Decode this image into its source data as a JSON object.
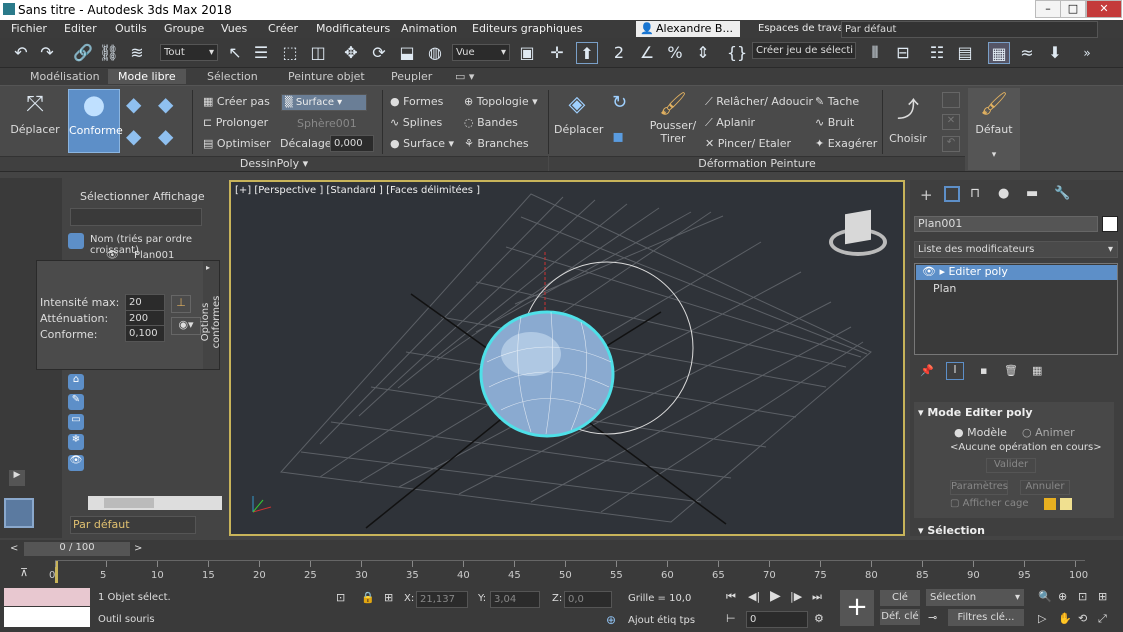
{
  "window": {
    "title": "Sans titre - Autodesk 3ds Max 2018"
  },
  "menu": [
    "Fichier",
    "Editer",
    "Outils",
    "Groupe",
    "Vues",
    "Créer",
    "Modificateurs",
    "Animation",
    "Editeurs graphiques"
  ],
  "user": "Alexandre B...",
  "workspace": {
    "label": "Espaces de travail:",
    "value": "Par défaut"
  },
  "toolbar": {
    "filter": "Tout",
    "view": "Vue",
    "selection_set": "Créer jeu de sélecti"
  },
  "ribbon_tabs": [
    "Modélisation",
    "Mode libre",
    "Sélection",
    "Peinture objet",
    "Peupler"
  ],
  "ribbon": {
    "deplacer": "Déplacer",
    "conforme": "Conforme",
    "creer_pas": "Créer pas",
    "prolonger": "Prolonger",
    "optimiser": "Optimiser",
    "surface_dd": "Surface",
    "sphere": "Sphère001",
    "decalage_label": "Décalage:",
    "decalage_value": "0,000",
    "formes": "Formes",
    "splines": "Splines",
    "surface": "Surface",
    "topologie": "Topologie",
    "bandes": "Bandes",
    "branches": "Branches",
    "deplacer2": "Déplacer",
    "pousser": "Pousser/",
    "tirer": "Tirer",
    "relacher": "Relâcher/ Adoucir",
    "aplanir": "Aplanir",
    "pincer": "Pincer/ Etaler",
    "tache": "Tache",
    "bruit": "Bruit",
    "exagerer": "Exagérer",
    "choisir": "Choisir",
    "defaut": "Défaut",
    "group1": "DessinPoly",
    "group2": "Déformation Peinture"
  },
  "scene": {
    "tab_select": "Sélectionner",
    "tab_display": "Affichage",
    "column": "Nom (triés par ordre croissant)",
    "item": "Plan001",
    "layer": "Par défaut"
  },
  "conform_opts": {
    "intensite_label": "Intensité max:",
    "intensite": "20",
    "attenuation_label": "Atténuation:",
    "attenuation": "200",
    "conforme_label": "Conforme:",
    "conforme": "0,100",
    "side": "Options conformes"
  },
  "viewport": {
    "label": "[+] [Perspective ] [Standard ] [Faces délimitées ]"
  },
  "cmd": {
    "object": "Plan001",
    "modlist": "Liste des modificateurs",
    "stack": [
      "Editer poly",
      "Plan"
    ],
    "rollout": "Mode Editer poly",
    "model": "Modèle",
    "animate": "Animer",
    "no_op": "<Aucune opération en cours>",
    "validate": "Valider",
    "params": "Paramètres",
    "cancel": "Annuler",
    "cage": "Afficher cage",
    "selection": "Sélection"
  },
  "timeline": {
    "frame": "0 / 100",
    "ticks": [
      "0",
      "5",
      "10",
      "15",
      "20",
      "25",
      "30",
      "35",
      "40",
      "45",
      "50",
      "55",
      "60",
      "65",
      "70",
      "75",
      "80",
      "85",
      "90",
      "95",
      "100"
    ]
  },
  "status": {
    "selected": "1 Objet sélect.",
    "tool": "Outil souris",
    "x_label": "X:",
    "x": "21,137",
    "y_label": "Y:",
    "y": "3,04",
    "z_label": "Z:",
    "z": "0,0",
    "grid": "Grille = 10,0",
    "autokey": "Clé auto",
    "setkey": "Déf. clé",
    "sel": "Sélection",
    "filters": "Filtres clé...",
    "frame_field": "0",
    "add_tag": "Ajout étiq tps"
  }
}
